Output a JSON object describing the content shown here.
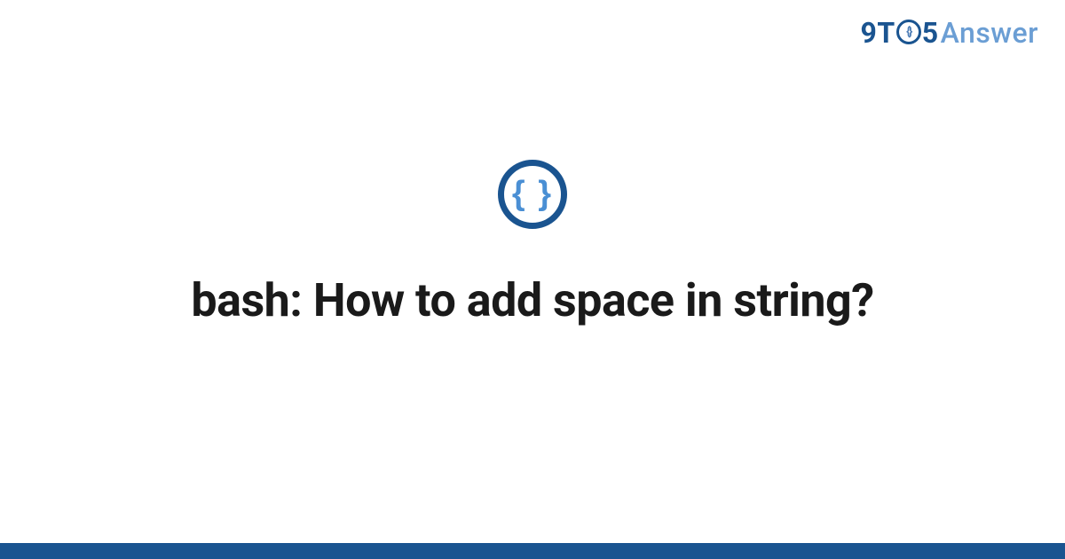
{
  "brand": {
    "part1": "9T",
    "circle_glyph": "{}",
    "part2": "5",
    "part3": "Answer"
  },
  "topic_icon": {
    "name": "code-braces-icon",
    "glyph": "{ }"
  },
  "question": {
    "title": "bash: How to add space in string?"
  },
  "colors": {
    "brand_dark": "#1a5490",
    "brand_light": "#6b9ed4",
    "brace_blue": "#4a8fd4"
  }
}
